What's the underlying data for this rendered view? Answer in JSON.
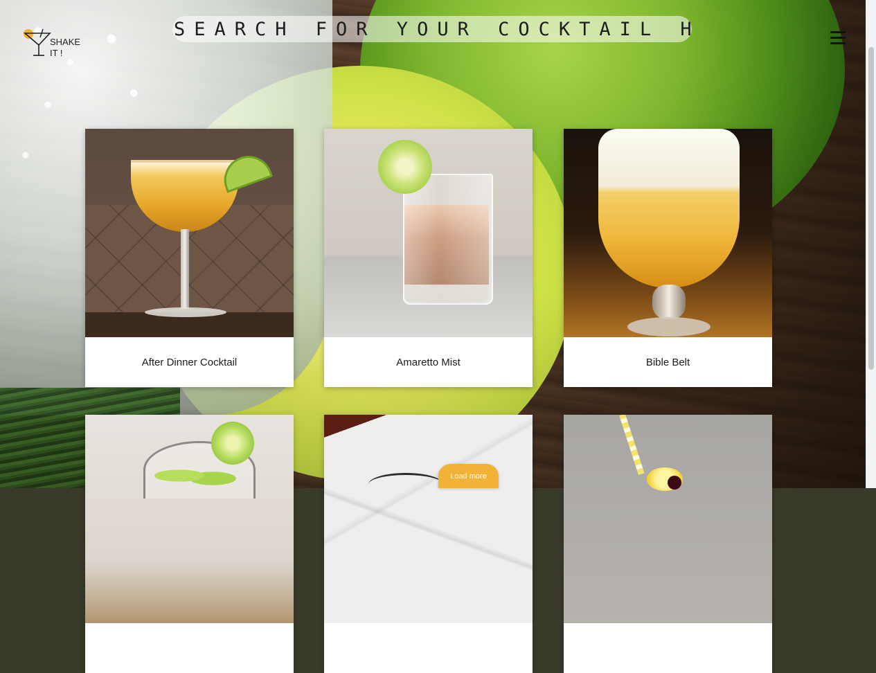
{
  "header": {
    "logo": {
      "line1": "SHAKE",
      "line2": "IT !",
      "icon": "cocktail-glass-icon",
      "accent_color": "#f2b238"
    },
    "search": {
      "placeholder": "SEARCH FOR YOUR COCKTAIL HERE",
      "value": ""
    },
    "menu_icon": "hamburger-menu-icon"
  },
  "cocktails": [
    {
      "name": "After Dinner Cocktail"
    },
    {
      "name": "Amaretto Mist"
    },
    {
      "name": "Bible Belt"
    },
    {
      "name": ""
    },
    {
      "name": ""
    },
    {
      "name": ""
    }
  ],
  "load_more": {
    "label": "Load more",
    "color": "#f2b238"
  }
}
